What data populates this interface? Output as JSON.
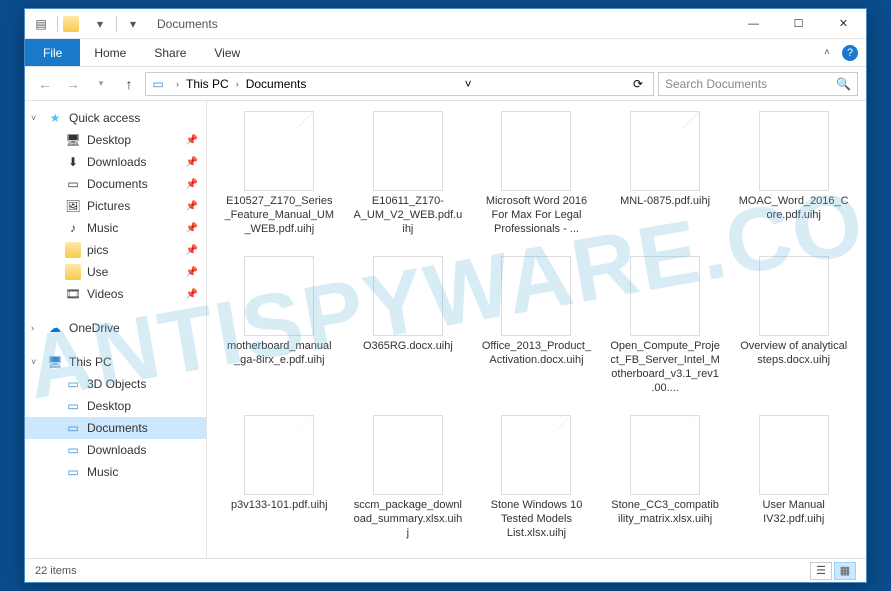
{
  "title": "Documents",
  "ribbon": {
    "file": "File",
    "home": "Home",
    "share": "Share",
    "view": "View"
  },
  "path": {
    "root": "This PC",
    "current": "Documents"
  },
  "search": {
    "placeholder": "Search Documents"
  },
  "sidebar": {
    "quick_access": {
      "label": "Quick access",
      "items": [
        {
          "label": "Desktop",
          "icon": "desktop",
          "pinned": true
        },
        {
          "label": "Downloads",
          "icon": "downloads",
          "pinned": true
        },
        {
          "label": "Documents",
          "icon": "doc",
          "pinned": true
        },
        {
          "label": "Pictures",
          "icon": "pictures",
          "pinned": true
        },
        {
          "label": "Music",
          "icon": "music",
          "pinned": true
        },
        {
          "label": "pics",
          "icon": "folder",
          "pinned": true
        },
        {
          "label": "Use",
          "icon": "folder",
          "pinned": true
        },
        {
          "label": "Videos",
          "icon": "videos",
          "pinned": true
        }
      ]
    },
    "onedrive": {
      "label": "OneDrive"
    },
    "thispc": {
      "label": "This PC",
      "items": [
        {
          "label": "3D Objects"
        },
        {
          "label": "Desktop"
        },
        {
          "label": "Documents",
          "selected": true
        },
        {
          "label": "Downloads"
        },
        {
          "label": "Music"
        }
      ]
    }
  },
  "files": [
    {
      "name": "E10527_Z170_Series_Feature_Manual_UM_WEB.pdf.uihj"
    },
    {
      "name": "E10611_Z170-A_UM_V2_WEB.pdf.uihj"
    },
    {
      "name": "Microsoft Word 2016 For Max For Legal Professionals - ..."
    },
    {
      "name": "MNL-0875.pdf.uihj"
    },
    {
      "name": "MOAC_Word_2016_Core.pdf.uihj"
    },
    {
      "name": "motherboard_manual_ga-8irx_e.pdf.uihj"
    },
    {
      "name": "O365RG.docx.uihj"
    },
    {
      "name": "Office_2013_Product_Activation.docx.uihj"
    },
    {
      "name": "Open_Compute_Project_FB_Server_Intel_Motherboard_v3.1_rev1.00...."
    },
    {
      "name": "Overview of analytical steps.docx.uihj"
    },
    {
      "name": "p3v133-101.pdf.uihj"
    },
    {
      "name": "sccm_package_download_summary.xlsx.uihj"
    },
    {
      "name": "Stone Windows 10 Tested Models List.xlsx.uihj"
    },
    {
      "name": "Stone_CC3_compatibility_matrix.xlsx.uihj"
    },
    {
      "name": "User Manual IV32.pdf.uihj"
    }
  ],
  "status": {
    "count": "22 items"
  },
  "watermark": "ANTISPYWARE.CO"
}
